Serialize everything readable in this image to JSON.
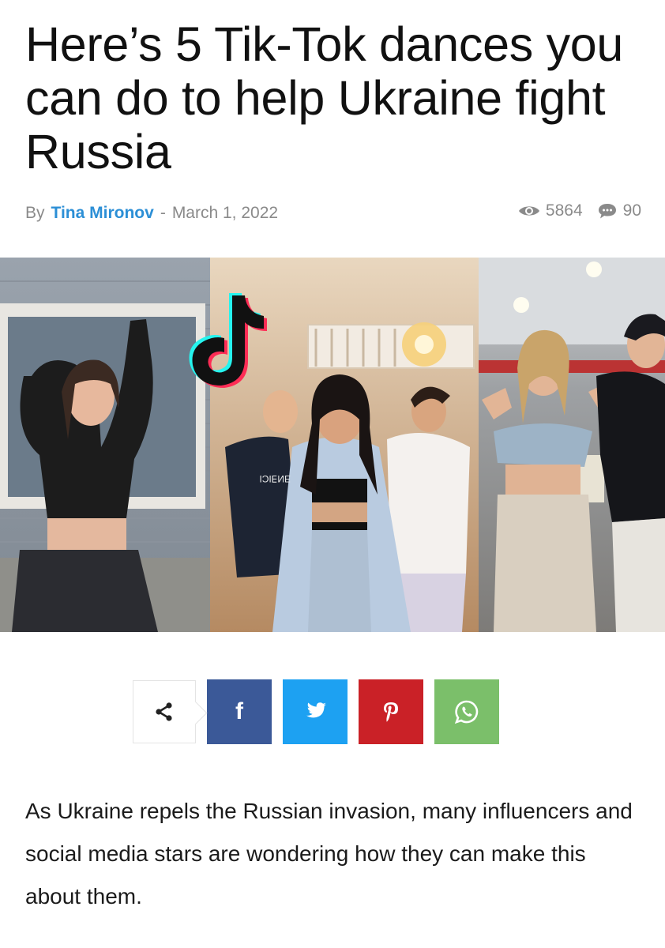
{
  "article": {
    "title": "Here’s 5 Tik-Tok dances you can do to help Ukraine fight Russia",
    "by_label": "By",
    "author": "Tina Mironov",
    "separator": "-",
    "date": "March 1, 2022",
    "views": "5864",
    "comments": "90",
    "body": "As Ukraine repels the Russian invasion, many influencers and social media stars are wondering how they can make this about them."
  },
  "hero": {
    "sign_text": "ƎИ∃ICI"
  },
  "share": {
    "buttons": [
      {
        "name": "facebook",
        "icon": "facebook-icon",
        "color": "#3b5998",
        "glyph": "f"
      },
      {
        "name": "twitter",
        "icon": "twitter-icon",
        "color": "#1da1f2"
      },
      {
        "name": "pinterest",
        "icon": "pinterest-icon",
        "color": "#ca2127"
      },
      {
        "name": "whatsapp",
        "icon": "whatsapp-icon",
        "color": "#7bbf6a"
      }
    ]
  },
  "colors": {
    "author_link": "#2c8fd6",
    "meta_text": "#8a8a8a"
  }
}
